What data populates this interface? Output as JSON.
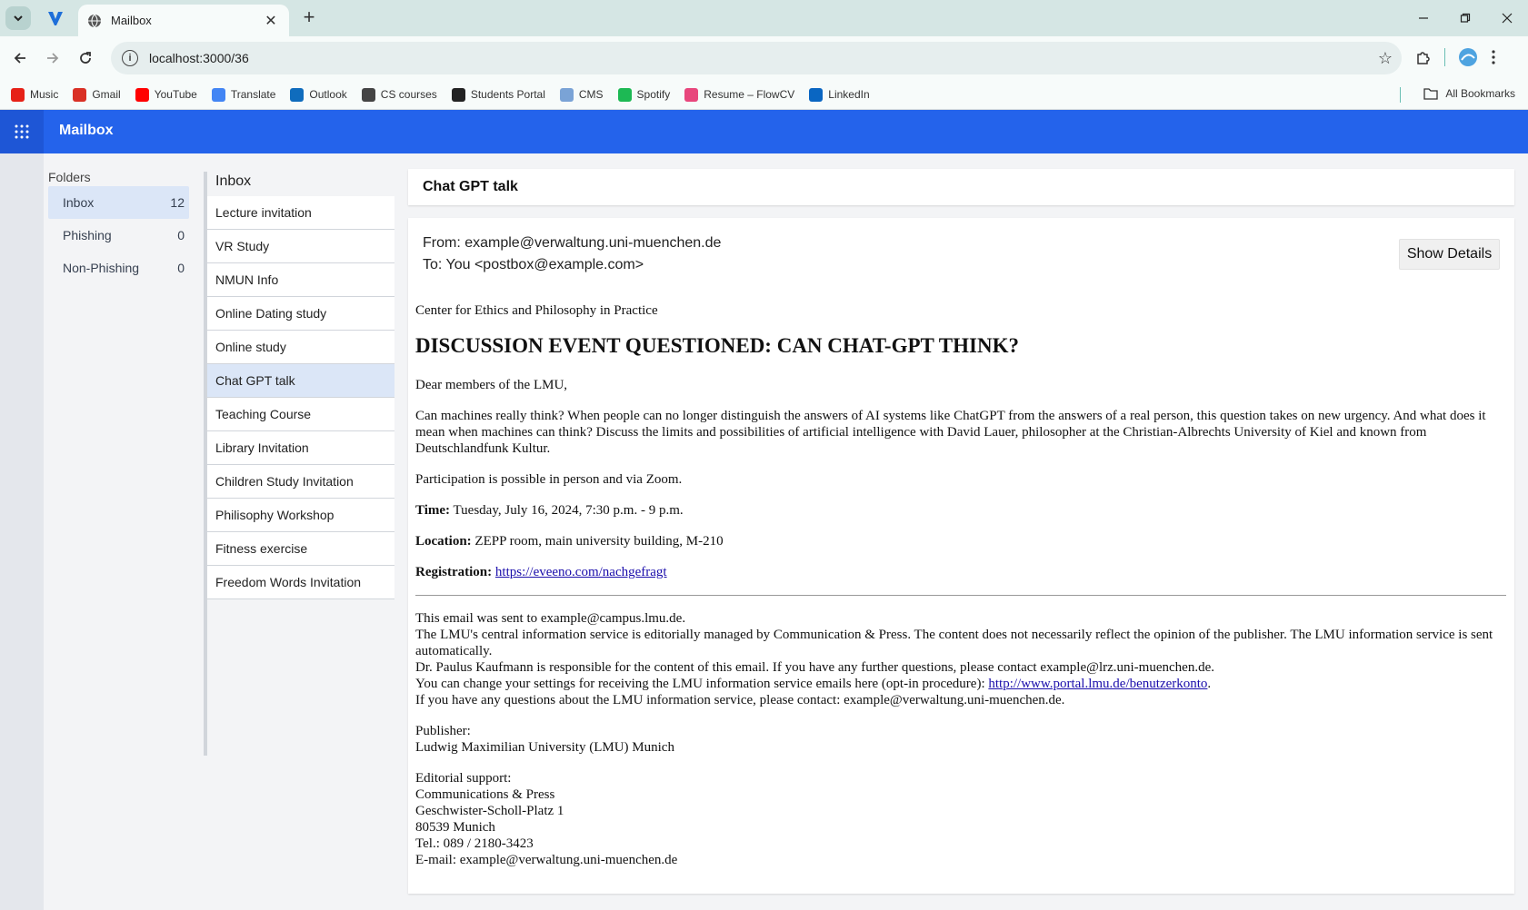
{
  "browser": {
    "tab_title": "Mailbox",
    "url": "localhost:3000/36",
    "bookmarks": [
      {
        "label": "Music",
        "icon": "youtube-music-icon",
        "color": "#e62117"
      },
      {
        "label": "Gmail",
        "icon": "gmail-icon",
        "color": "#d93025"
      },
      {
        "label": "YouTube",
        "icon": "youtube-icon",
        "color": "#ff0000"
      },
      {
        "label": "Translate",
        "icon": "translate-icon",
        "color": "#4285f4"
      },
      {
        "label": "Outlook",
        "icon": "outlook-icon",
        "color": "#0f6cbd"
      },
      {
        "label": "CS courses",
        "icon": "folder-icon",
        "color": "#444444"
      },
      {
        "label": "Students Portal",
        "icon": "globe-icon",
        "color": "#222222"
      },
      {
        "label": "CMS",
        "icon": "document-icon",
        "color": "#7aa3d6"
      },
      {
        "label": "Spotify",
        "icon": "spotify-icon",
        "color": "#1db954"
      },
      {
        "label": "Resume – FlowCV",
        "icon": "flowcv-icon",
        "color": "#e8467c"
      },
      {
        "label": "LinkedIn",
        "icon": "linkedin-icon",
        "color": "#0a66c2"
      }
    ],
    "all_bookmarks": "All Bookmarks"
  },
  "app": {
    "title": "Mailbox",
    "accent": "#2463eb"
  },
  "folders": {
    "title": "Folders",
    "items": [
      {
        "label": "Inbox",
        "count": "12"
      },
      {
        "label": "Phishing",
        "count": "0"
      },
      {
        "label": "Non-Phishing",
        "count": "0"
      }
    ]
  },
  "inbox": {
    "title": "Inbox",
    "items": [
      "Lecture invitation",
      "VR Study",
      "NMUN Info",
      "Online Dating study",
      "Online study",
      "Chat GPT talk",
      "Teaching Course",
      "Library Invitation",
      "Children Study Invitation",
      "Philisophy Workshop",
      "Fitness exercise",
      "Freedom Words Invitation"
    ],
    "selected": "Chat GPT talk"
  },
  "email": {
    "subject": "Chat GPT talk",
    "from": "From: example@verwaltung.uni-muenchen.de",
    "to": "To: You <postbox@example.com>",
    "show_details": "Show Details",
    "org": "Center for Ethics and Philosophy in Practice",
    "headline": "DISCUSSION EVENT QUESTIONED: CAN CHAT-GPT THINK?",
    "greeting": "Dear members of the LMU,",
    "intro": "Can machines really think? When people can no longer distinguish the answers of AI systems like ChatGPT from the answers of a real person, this question takes on new urgency. And what does it mean when machines can think? Discuss the limits and possibilities of artificial intelligence with David Lauer, philosopher at the Christian-Albrechts University of Kiel and known from Deutschlandfunk Kultur.",
    "participation": "Participation is possible in person and via Zoom.",
    "time_label": "Time:",
    "time_value": " Tuesday, July 16, 2024, 7:30 p.m. - 9 p.m.",
    "location_label": "Location:",
    "location_value": " ZEPP room, main university building, M-210",
    "registration_label": "Registration:",
    "registration_link": "https://eveeno.com/nachgefragt",
    "footer_sent": "This email was sent to example@campus.lmu.de.",
    "footer_managed": "The LMU's central information service is editorially managed by Communication & Press. The content does not necessarily reflect the opinion of the publisher. The LMU information service is sent automatically.",
    "footer_responsible": "Dr. Paulus Kaufmann is responsible for the content of this email. If you have any further questions, please contact example@lrz.uni-muenchen.de.",
    "footer_settings_text": "You can change your settings for receiving the LMU information service emails here (opt-in procedure): ",
    "footer_settings_link": "http://www.portal.lmu.de/benutzerkonto",
    "footer_settings_end": ".",
    "footer_questions": "If you have any questions about the LMU information service, please contact: example@verwaltung.uni-muenchen.de.",
    "publisher_label": "Publisher:",
    "publisher_name": "Ludwig Maximilian University (LMU) Munich",
    "editorial_label": "Editorial support:",
    "editorial_lines": [
      "Communications & Press",
      "Geschwister-Scholl-Platz 1",
      "80539 Munich",
      "Tel.: 089 / 2180-3423",
      "E-mail: example@verwaltung.uni-muenchen.de"
    ]
  }
}
